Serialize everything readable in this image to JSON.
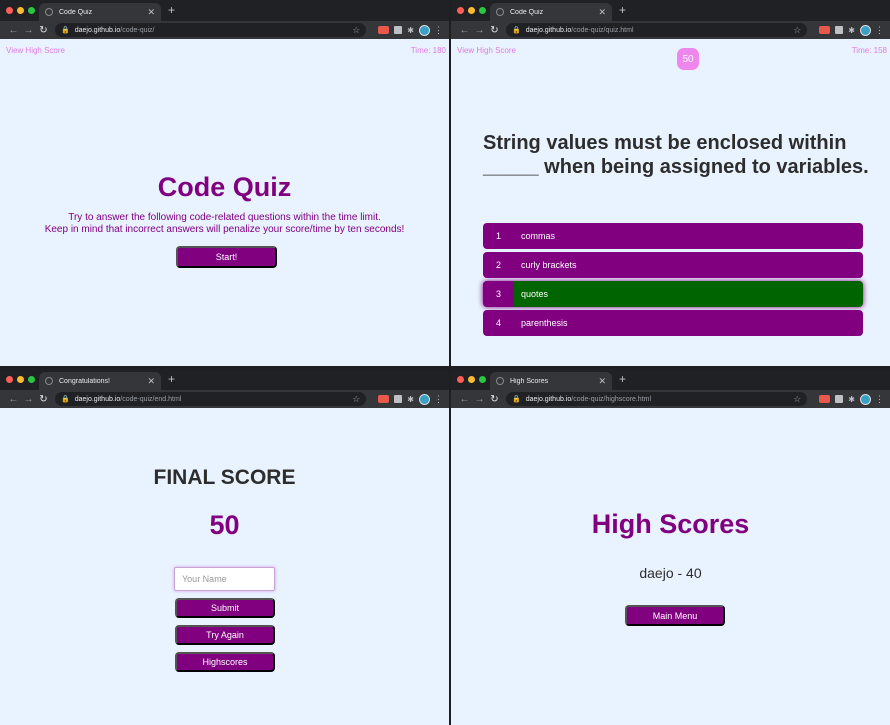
{
  "windows": [
    {
      "tab_title": "Code Quiz",
      "url_host": "daejo.github.io",
      "url_path": "/code-quiz/",
      "view_high_score": "View High Score",
      "timer": "Time: 180",
      "title": "Code Quiz",
      "intro_line1": "Try to answer the following code-related questions within the time limit.",
      "intro_line2": "Keep in mind that incorrect answers will penalize your score/time by ten seconds!",
      "start_label": "Start!"
    },
    {
      "tab_title": "Code Quiz",
      "url_host": "daejo.github.io",
      "url_path": "/code-quiz/quiz.html",
      "view_high_score": "View High Score",
      "timer": "Time: 158",
      "score": "50",
      "question": "String values must be enclosed within _____ when being assigned to variables.",
      "answers": [
        {
          "num": "1",
          "text": "commas"
        },
        {
          "num": "2",
          "text": "curly brackets"
        },
        {
          "num": "3",
          "text": "quotes"
        },
        {
          "num": "4",
          "text": "parenthesis"
        }
      ]
    },
    {
      "tab_title": "Congratulations!",
      "url_host": "daejo.github.io",
      "url_path": "/code-quiz/end.html",
      "final_title": "FINAL SCORE",
      "final_score": "50",
      "name_placeholder": "Your Name",
      "submit_label": "Submit",
      "try_again_label": "Try Again",
      "highscores_label": "Highscores"
    },
    {
      "tab_title": "High Scores",
      "url_host": "daejo.github.io",
      "url_path": "/code-quiz/highscore.html",
      "title": "High Scores",
      "entry": "daejo - 40",
      "main_menu_label": "Main Menu"
    }
  ],
  "colors": {
    "accent": "#800080",
    "correct": "#006400",
    "page_bg": "#e9f3ff",
    "link": "#e07be0"
  }
}
